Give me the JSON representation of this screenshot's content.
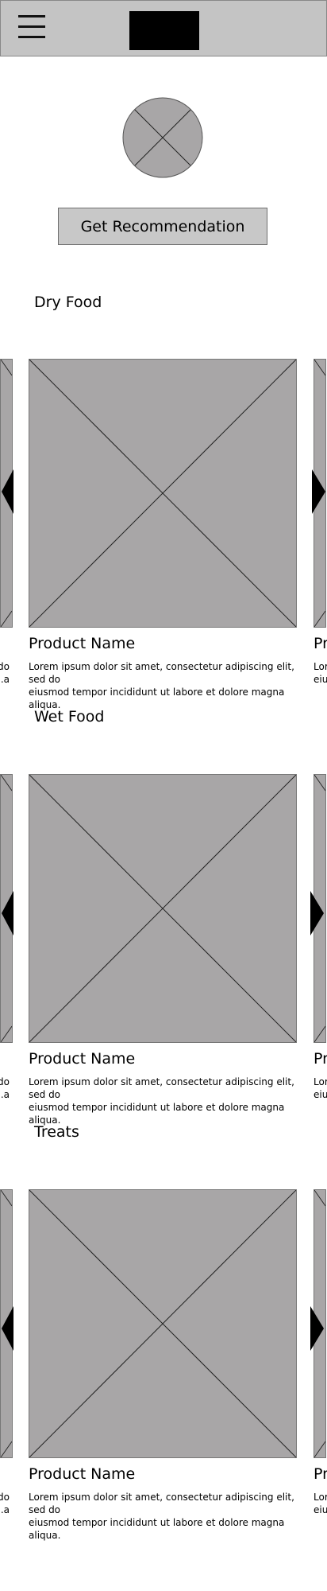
{
  "header": {
    "menu_icon": "hamburger-menu-icon",
    "logo": "logo-placeholder"
  },
  "avatar_icon": "image-placeholder-icon",
  "recommendation_button": "Get Recommendation",
  "sections": [
    {
      "title": "Dry Food",
      "product": {
        "name": "Product Name",
        "description_line1": "Lorem ipsum dolor sit amet, consectetur adipiscing elit, sed do",
        "description_line2": "eiusmod tempor incididunt ut labore et dolore magna aliqua."
      },
      "peek_left_line1": "do",
      "peek_left_line2": "a.",
      "peek_right_name": "Pr",
      "peek_right_line1": "Lor",
      "peek_right_line2": "eiu"
    },
    {
      "title": "Wet Food",
      "product": {
        "name": "Product Name",
        "description_line1": "Lorem ipsum dolor sit amet, consectetur adipiscing elit, sed do",
        "description_line2": "eiusmod tempor incididunt ut labore et dolore magna aliqua."
      },
      "peek_left_line1": "do",
      "peek_left_line2": "a.",
      "peek_right_name": "Pr",
      "peek_right_line1": "Lor",
      "peek_right_line2": "eiu"
    },
    {
      "title": "Treats",
      "product": {
        "name": "Product Name",
        "description_line1": "Lorem ipsum dolor sit amet, consectetur adipiscing elit, sed do",
        "description_line2": "eiusmod tempor incididunt ut labore et dolore magna aliqua."
      },
      "peek_left_line1": "do",
      "peek_left_line2": "a.",
      "peek_right_name": "Pr",
      "peek_right_line1": "Lor",
      "peek_right_line2": "eiu"
    }
  ]
}
